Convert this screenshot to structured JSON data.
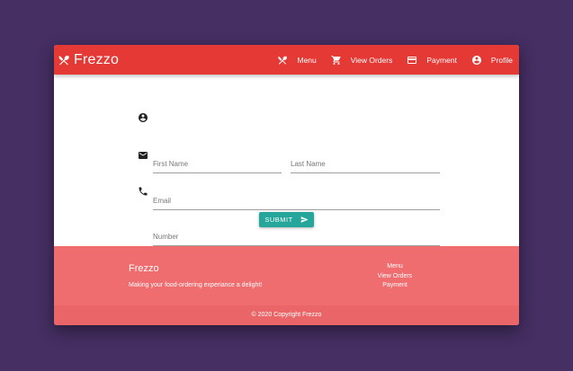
{
  "navbar": {
    "brand": "Frezzo",
    "items": [
      {
        "label": "Menu",
        "icon": "utensils-icon"
      },
      {
        "label": "View Orders",
        "icon": "cart-icon"
      },
      {
        "label": "Payment",
        "icon": "credit-card-icon"
      },
      {
        "label": "Profile",
        "icon": "account-circle-icon"
      }
    ]
  },
  "form": {
    "first_name_placeholder": "First Name",
    "last_name_placeholder": "Last Name",
    "email_placeholder": "Email",
    "number_placeholder": "Number",
    "submit_label": "SUBMIT"
  },
  "footer": {
    "title": "Frezzo",
    "tagline": "Making your food-ordering experiance a delight!",
    "links": [
      "Menu",
      "View Orders",
      "Payment"
    ],
    "copyright": "© 2020 Copyright Frezzo"
  },
  "colors": {
    "navbar": "#e53935",
    "footer": "#ef6c6f",
    "button": "#26a69a",
    "background": "#452f63"
  }
}
